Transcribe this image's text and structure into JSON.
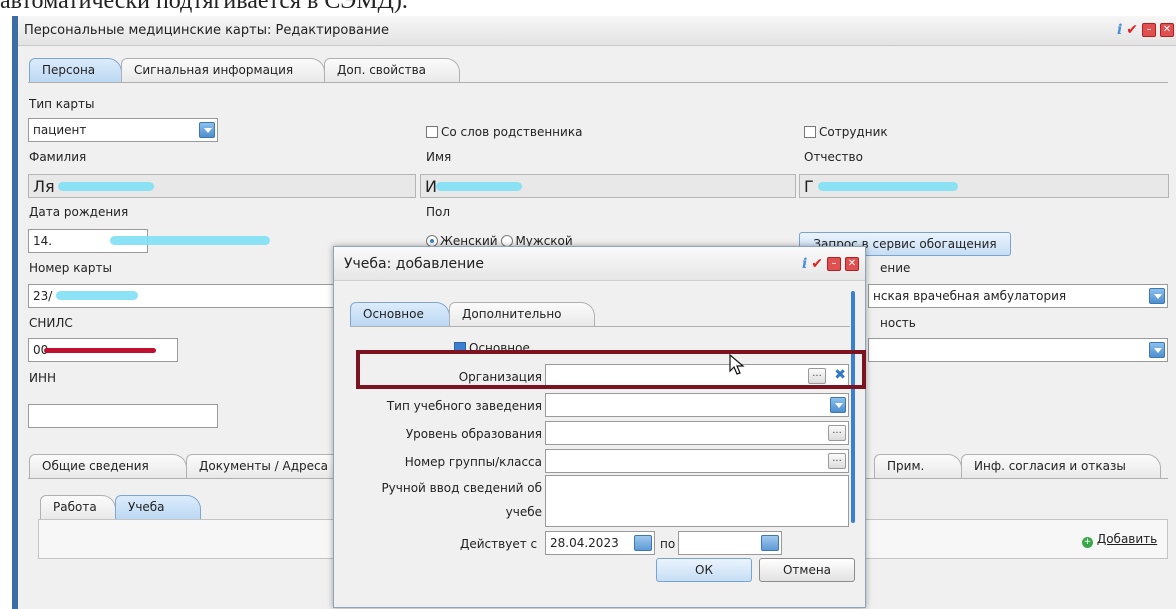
{
  "document": {
    "partial_text": "автоматически подтягивается в СЭМД)."
  },
  "window": {
    "title": "Персональные медицинские карты: Редактирование",
    "tabs": [
      "Персона",
      "Сигнальная информация",
      "Доп. свойства"
    ],
    "form": {
      "card_type_label": "Тип карты",
      "card_type_value": "пациент",
      "from_relative_label": "Со слов родственника",
      "employee_label": "Сотрудник",
      "surname_label": "Фамилия",
      "surname_value": "Ля",
      "name_label": "Имя",
      "name_value": "И",
      "patronymic_label": "Отчество",
      "patronymic_value": "Г",
      "birth_label": "Дата рождения",
      "birth_value": "14.",
      "sex_label": "Пол",
      "sex_female": "Женский",
      "sex_male": "Мужской",
      "enrich_button": "Запрос в сервис обогащения",
      "card_number_label": "Номер карты",
      "card_number_value": "23/",
      "division_label_partial": "ение",
      "division_value_partial": "нская врачебная амбулатория",
      "snils_label": "СНИЛС",
      "snils_value": "00",
      "post_label_partial": "ность",
      "inn_label": "ИНН"
    },
    "lower_tabs": [
      "Общие сведения",
      "Документы / Адреса"
    ],
    "lower_tabs_right": [
      "Прим.",
      "Инф. согласия и отказы"
    ],
    "sub_tabs": [
      "Работа",
      "Учеба"
    ],
    "add_link": "Добавить"
  },
  "dialog": {
    "title": "Учеба: добавление",
    "tabs": [
      "Основное",
      "Дополнительно"
    ],
    "main_checkbox_label": "Основное",
    "organization_label": "Организация",
    "school_type_label": "Тип учебного заведения",
    "education_level_label": "Уровень образования",
    "group_label": "Номер группы/класса",
    "manual_label_1": "Ручной ввод сведений об",
    "manual_label_2": "учебе",
    "valid_from_label": "Действует с",
    "valid_from_value": "28.04.2023",
    "valid_to_label": "по",
    "ok_button": "ОК",
    "cancel_button": "Отмена"
  },
  "colors": {
    "accent": "#3b7fd0",
    "highlight": "#7b1420",
    "close": "#e05050"
  }
}
